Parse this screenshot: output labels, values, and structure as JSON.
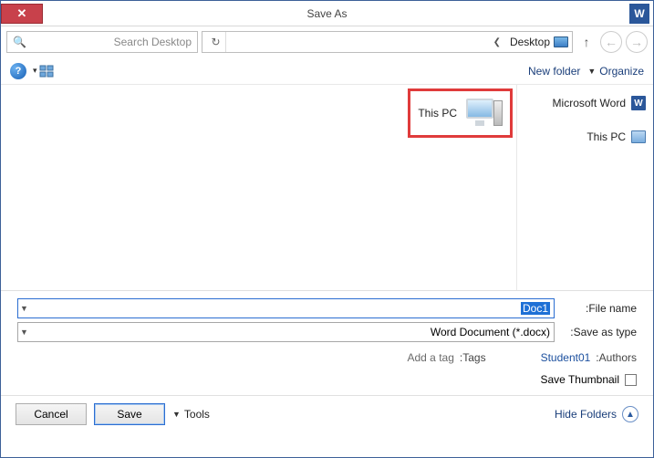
{
  "title": "Save As",
  "app_icon_letter": "W",
  "nav": {
    "breadcrumb_location": "Desktop",
    "refresh_glyph": "↻",
    "search_placeholder": "Search Desktop"
  },
  "toolbar": {
    "organize": "Organize",
    "new_folder": "New folder",
    "help_glyph": "?"
  },
  "sidebar": {
    "items": [
      {
        "label": "Microsoft Word",
        "icon": "word"
      },
      {
        "label": "This PC",
        "icon": "pc"
      }
    ]
  },
  "filepane": {
    "highlighted_item_label": "This PC"
  },
  "form": {
    "filename_label": "File name:",
    "filename_value": "Doc1",
    "savetype_label": "Save as type:",
    "savetype_value": "Word Document (*.docx)",
    "authors_label": "Authors:",
    "authors_value": "Student01",
    "tags_label": "Tags:",
    "tags_value": "Add a tag",
    "save_thumbnail_label": "Save Thumbnail"
  },
  "footer": {
    "hide_folders": "Hide Folders",
    "tools": "Tools",
    "save": "Save",
    "cancel": "Cancel"
  }
}
